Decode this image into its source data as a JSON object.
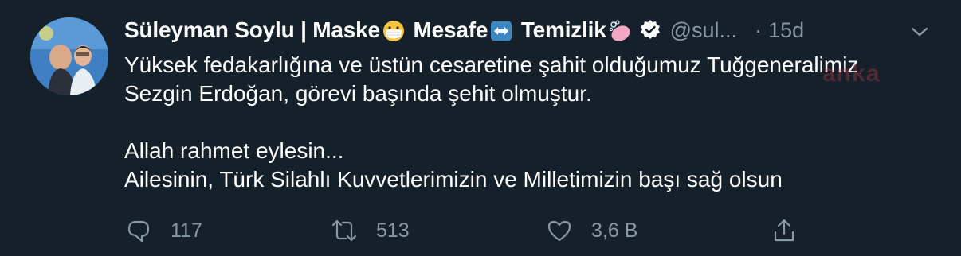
{
  "tweet": {
    "author": {
      "name_part1": "Süleyman Soylu | Maske",
      "name_part2": " Mesafe",
      "name_part3": " Temizlik",
      "handle": "@sul...",
      "separator": "·",
      "time": "15d"
    },
    "text": {
      "line1": "Yüksek fedakarlığına ve üstün cesaretine şahit olduğumuz Tuğgeneralimiz",
      "line2": "Sezgin Erdoğan, görevi başında şehit olmuştur.",
      "line3": "Allah rahmet eylesin...",
      "line4": "Ailesinin, Türk Silahlı Kuvvetlerimizin ve Milletimizin başı sağ olsun"
    },
    "watermark": "anka",
    "actions": {
      "reply_count": "117",
      "retweet_count": "513",
      "like_count": "3,6 B"
    }
  },
  "icons": {
    "mask": "face-with-medical-mask-icon",
    "arrows": "left-right-arrow-icon",
    "soap": "soap-icon",
    "verified": "verified-badge-icon",
    "caret": "chevron-down-icon",
    "reply": "reply-icon",
    "retweet": "retweet-icon",
    "like": "heart-icon",
    "share": "share-icon"
  },
  "colors": {
    "background": "#15202b",
    "secondary_text": "#8899a6",
    "primary_text": "#ffffff"
  }
}
